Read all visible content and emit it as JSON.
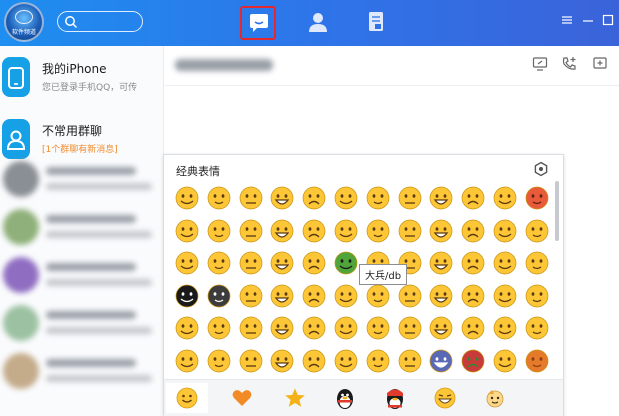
{
  "topbar": {
    "logo_text": "软件频道",
    "search_placeholder": "",
    "tabs": [
      {
        "name": "messages",
        "active": true
      },
      {
        "name": "contacts",
        "active": false
      },
      {
        "name": "space",
        "active": false
      }
    ],
    "highlight_color": "#e3282f"
  },
  "sidebar": {
    "items": [
      {
        "title": "我的iPhone",
        "subtitle": "您已登录手机QQ，可传"
      },
      {
        "title": "不常用群聊",
        "subtitle": "[1个群聊有新消息]"
      }
    ]
  },
  "emoji_panel": {
    "title": "经典表情",
    "tooltip": "大兵/db",
    "categories": [
      "default-face",
      "heart",
      "star",
      "qq-penguin",
      "qq-penguin-red",
      "laughing-face",
      "cartoon-sticker"
    ]
  },
  "colors": {
    "topbar": "#2f73e8",
    "emoji_yellow": "#fcc636",
    "orange_text": "#ef8e2f"
  }
}
